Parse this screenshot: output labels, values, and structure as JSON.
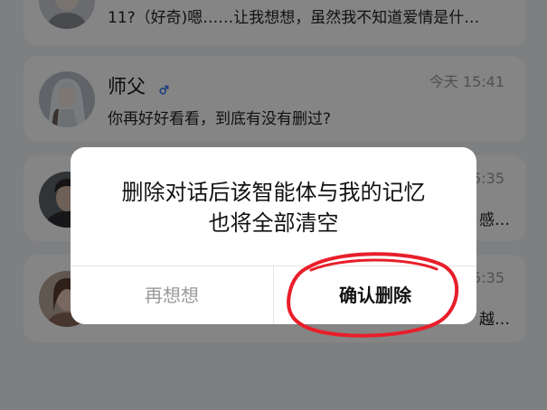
{
  "chats": [
    {
      "message": "11?（好奇)嗯……让我想想，虽然我不知道爱情是什…"
    },
    {
      "name": "师父",
      "time": "今天 15:41",
      "message": "你再好好看看，到底有没有删过?",
      "gender_icon": "male-icon"
    },
    {
      "time_partial": "5:35",
      "message_partial": "感…"
    },
    {
      "time_partial": "5:35",
      "message_partial": "越…"
    }
  ],
  "dialog": {
    "message_line1": "删除对话后该智能体与我的记忆",
    "message_line2": "也将全部清空",
    "cancel_label": "再想想",
    "confirm_label": "确认删除"
  },
  "colors": {
    "gender_blue": "#3d7bf7",
    "annotation_red": "#e81f2a"
  }
}
